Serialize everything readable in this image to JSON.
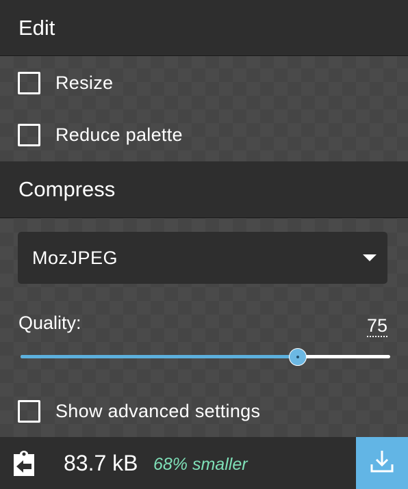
{
  "edit": {
    "title": "Edit",
    "resize_label": "Resize",
    "reduce_palette_label": "Reduce palette"
  },
  "compress": {
    "title": "Compress",
    "method": "MozJPEG",
    "quality_label": "Quality:",
    "quality_value": "75",
    "quality_fraction": 0.75,
    "advanced_label": "Show advanced settings"
  },
  "footer": {
    "size": "83.7 kB",
    "reduction": "68% smaller",
    "back_icon": "back-arrow-icon",
    "download_icon": "download-icon"
  },
  "colors": {
    "accent": "#62b5e5",
    "reduction_text": "#7fe0b8",
    "header_bg": "#2e2e2e"
  }
}
